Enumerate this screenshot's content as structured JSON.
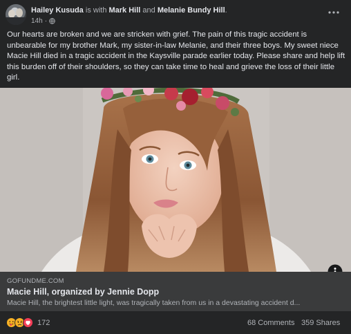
{
  "post": {
    "author": "Hailey Kusuda",
    "with_text": "is with",
    "tagged_1": "Mark Hill",
    "and_text": "and",
    "tagged_2": "Melanie Bundy Hill",
    "period": ".",
    "time": "14h",
    "separator": "·",
    "audience_icon": "globe-icon",
    "text": "Our hearts are broken and we are stricken with grief. The pain of this tragic accident is unbearable for my brother Mark, my sister-in-law Melanie, and their three boys. My sweet niece Macie Hill died in a tragic accident in the Kaysville parade earlier today. Please share and help lift this burden off of their shoulders, so they can take time to heal and grieve the loss of their little girl."
  },
  "link_preview": {
    "domain": "GOFUNDME.COM",
    "title": "Macie Hill, organized by Jennie Dopp",
    "description": "Macie Hill, the brightest little light, was tragically taken from us in a devastating accident d..."
  },
  "footer": {
    "reactions": [
      "care-icon",
      "sad-icon",
      "love-icon"
    ],
    "reaction_count": "172",
    "comments": "68 Comments",
    "shares": "359 Shares"
  },
  "colors": {
    "background": "#242526",
    "link_box": "#3a3b3c",
    "text_primary": "#e4e6eb",
    "text_secondary": "#b0b3b8"
  }
}
